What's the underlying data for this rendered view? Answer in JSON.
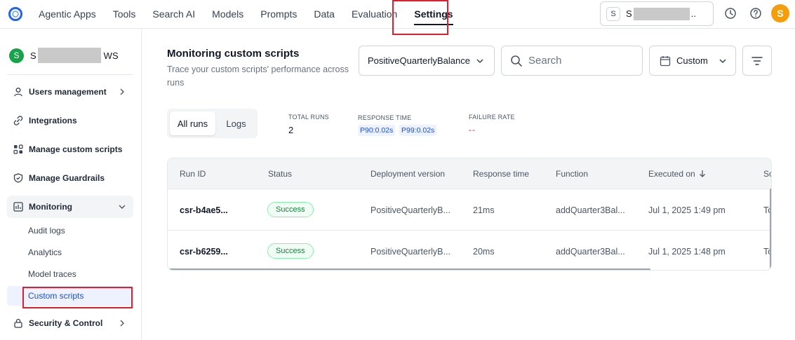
{
  "nav": {
    "tabs": [
      {
        "label": "Agentic Apps"
      },
      {
        "label": "Tools"
      },
      {
        "label": "Search AI"
      },
      {
        "label": "Models"
      },
      {
        "label": "Prompts"
      },
      {
        "label": "Data"
      },
      {
        "label": "Evaluation"
      },
      {
        "label": "Settings"
      }
    ],
    "active_tab": "Settings",
    "workspace": {
      "badge": "S",
      "prefix": "S",
      "suffix": ".."
    },
    "avatar_initial": "S",
    "icons": [
      "history-icon",
      "help-icon"
    ]
  },
  "sidebar": {
    "workspace": {
      "initial": "S",
      "prefix": "S",
      "suffix": "WS"
    },
    "items": [
      {
        "label": "Users management",
        "icon": "user-icon",
        "chevron": "right"
      },
      {
        "label": "Integrations",
        "icon": "link-icon"
      },
      {
        "label": "Manage custom scripts",
        "icon": "scripts-icon"
      },
      {
        "label": "Manage Guardrails",
        "icon": "shield-icon"
      },
      {
        "label": "Monitoring",
        "icon": "chart-icon",
        "chevron": "down"
      },
      {
        "label": "Security & Control",
        "icon": "lock-icon",
        "chevron": "right"
      }
    ],
    "monitoring_sub": [
      {
        "label": "Audit logs"
      },
      {
        "label": "Analytics"
      },
      {
        "label": "Model traces"
      },
      {
        "label": "Custom scripts"
      }
    ],
    "active_sub": "Custom scripts"
  },
  "main": {
    "title": "Monitoring custom scripts",
    "subtitle": "Trace your custom scripts' performance across runs",
    "script_select": {
      "value": "PositiveQuarterlyBalance"
    },
    "search": {
      "placeholder": "Search"
    },
    "date_select": {
      "value": "Custom"
    },
    "tabs": [
      {
        "label": "All runs"
      },
      {
        "label": "Logs"
      }
    ],
    "active_tab": "All runs",
    "stats": {
      "total_runs": {
        "label": "TOTAL RUNS",
        "value": "2"
      },
      "response_time": {
        "label": "RESPONSE TIME",
        "p90": "P90:0.02s",
        "p99": "P99:0.02s"
      },
      "failure_rate": {
        "label": "FAILURE RATE",
        "value": "--"
      }
    },
    "table": {
      "columns": [
        "Run ID",
        "Status",
        "Deployment version",
        "Response time",
        "Function",
        "Executed on",
        "So"
      ],
      "sort_column": "Executed on",
      "rows": [
        {
          "run_id": "csr-b4ae5...",
          "status": "Success",
          "deployment": "PositiveQuarterlyB...",
          "response_time": "21ms",
          "function": "addQuarter3Bal...",
          "executed_on": "Jul 1, 2025 1:49 pm",
          "source": "To"
        },
        {
          "run_id": "csr-b6259...",
          "status": "Success",
          "deployment": "PositiveQuarterlyB...",
          "response_time": "20ms",
          "function": "addQuarter3Bal...",
          "executed_on": "Jul 1, 2025 1:48 pm",
          "source": "To"
        }
      ]
    }
  },
  "colors": {
    "highlight_red": "#e11d2e",
    "accent_blue": "#1d4ed8",
    "success_green": "#15803d",
    "avatar_orange": "#f59e0b",
    "ws_green": "#16a34a"
  }
}
